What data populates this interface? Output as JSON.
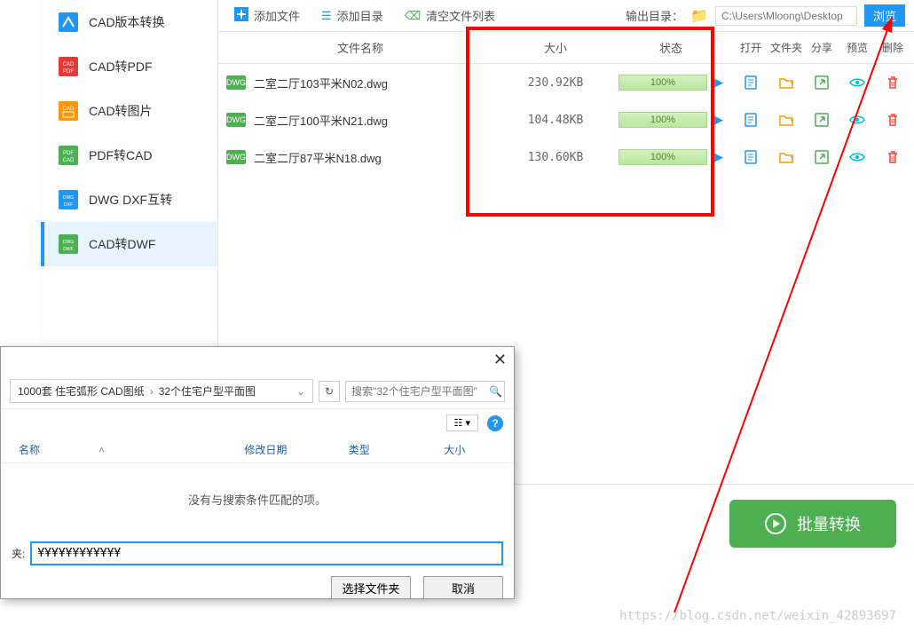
{
  "sidebar": {
    "items": [
      {
        "label": "CAD版本转换",
        "icon": "cad-version",
        "color": "#2196f3"
      },
      {
        "label": "CAD转PDF",
        "icon": "cad-pdf",
        "color": "#e53935"
      },
      {
        "label": "CAD转图片",
        "icon": "cad-image",
        "color": "#ff9800"
      },
      {
        "label": "PDF转CAD",
        "icon": "pdf-cad",
        "color": "#4caf50"
      },
      {
        "label": "DWG DXF互转",
        "icon": "dwg-dxf",
        "color": "#2196f3"
      },
      {
        "label": "CAD转DWF",
        "icon": "cad-dwf",
        "color": "#4caf50"
      }
    ],
    "active_index": 5
  },
  "toolbar": {
    "add_file": "添加文件",
    "add_dir": "添加目录",
    "clear_list": "清空文件列表",
    "output_label": "输出目录：",
    "output_path": "C:\\Users\\Mloong\\Desktop",
    "browse": "浏览"
  },
  "table": {
    "headers": {
      "name": "文件名称",
      "size": "大小",
      "status": "状态",
      "open": "打开",
      "folder": "文件夹",
      "share": "分享",
      "preview": "预览",
      "delete": "删除"
    },
    "rows": [
      {
        "badge": "DWG",
        "name": "二室二厅103平米N02.dwg",
        "size": "230.92KB",
        "progress": "100%"
      },
      {
        "badge": "DWG",
        "name": "二室二厅100平米N21.dwg",
        "size": "104.48KB",
        "progress": "100%"
      },
      {
        "badge": "DWG",
        "name": "二室二厅87平米N18.dwg",
        "size": "130.60KB",
        "progress": "100%"
      }
    ]
  },
  "batch_button": "批量转换",
  "dialog": {
    "breadcrumb": [
      "1000套 住宅弧形 CAD图纸",
      "32个住宅户型平面图"
    ],
    "search_placeholder": "搜索\"32个住宅户型平面图\"",
    "columns": {
      "name": "名称",
      "date": "修改日期",
      "type": "类型",
      "size": "大小"
    },
    "empty_msg": "没有与搜索条件匹配的项。",
    "folder_label": "夹:",
    "folder_value": "¥¥¥¥¥¥¥¥¥¥¥¥",
    "select_btn": "选择文件夹",
    "cancel_btn": "取消"
  },
  "watermark": "https://blog.csdn.net/weixin_42893697"
}
